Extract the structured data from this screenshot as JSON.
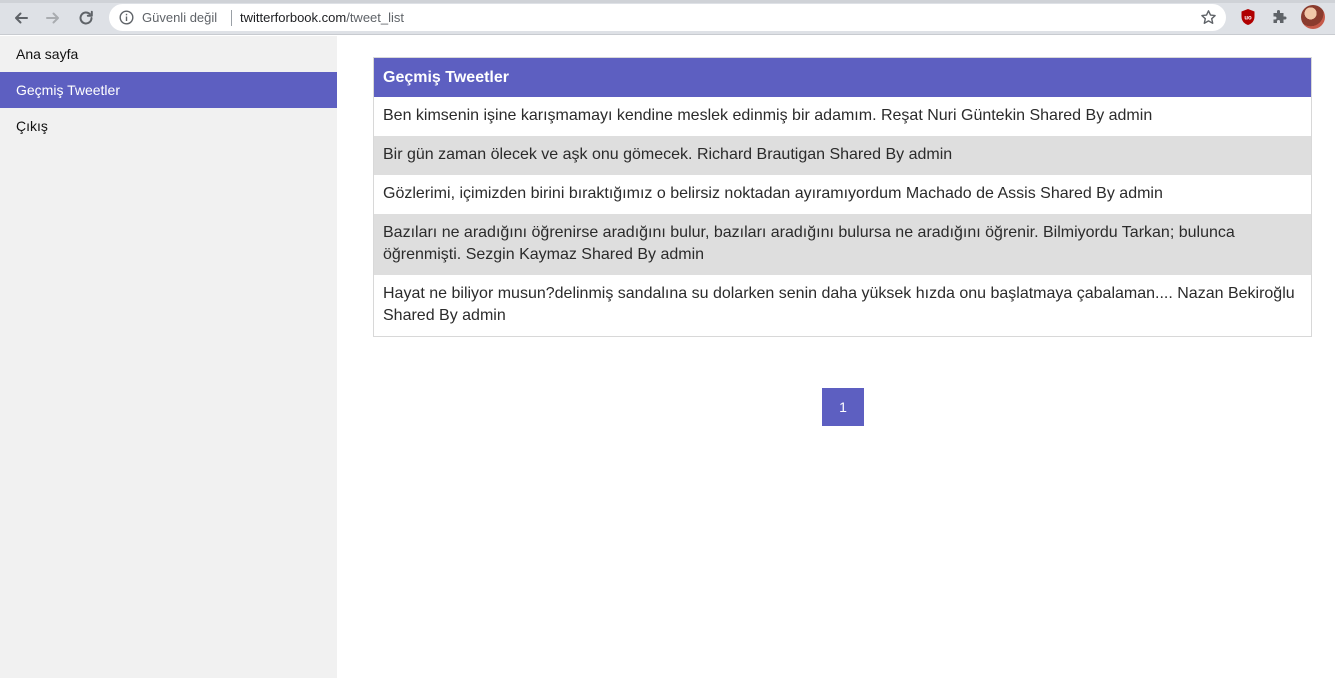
{
  "browser": {
    "security_label": "Güvenli değil",
    "url_host": "twitterforbook.com",
    "url_path": "/tweet_list",
    "icons": [
      "back-icon",
      "forward-icon",
      "reload-icon",
      "info-icon",
      "star-icon",
      "ublock-icon",
      "extensions-icon"
    ]
  },
  "sidebar": {
    "items": [
      {
        "label": "Ana sayfa",
        "active": false
      },
      {
        "label": "Geçmiş Tweetler",
        "active": true
      },
      {
        "label": "Çıkış",
        "active": false
      }
    ]
  },
  "main": {
    "table_title": "Geçmiş Tweetler",
    "tweets": [
      "Ben kimsenin işine karışmamayı kendine meslek edinmiş bir adamım. Reşat Nuri Güntekin Shared By admin",
      "Bir gün zaman ölecek ve aşk onu gömecek. Richard Brautigan Shared By admin",
      "Gözlerimi, içimizden birini bıraktığımız o belirsiz noktadan ayıramıyordum Machado de Assis Shared By admin",
      "Bazıları ne aradığını öğrenirse aradığını bulur, bazıları aradığını bulursa ne aradığını öğrenir. Bilmiyordu Tarkan; bulunca öğrenmişti. Sezgin Kaymaz Shared By admin",
      "Hayat ne biliyor musun?delinmiş sandalına su dolarken senin daha yüksek hızda onu başlatmaya çabalaman.... Nazan Bekiroğlu Shared By admin"
    ],
    "pagination": {
      "current_page": "1"
    }
  },
  "colors": {
    "accent": "#5d5fc1",
    "sidebar_bg": "#f1f1f1",
    "row_alt_bg": "#dedede"
  }
}
